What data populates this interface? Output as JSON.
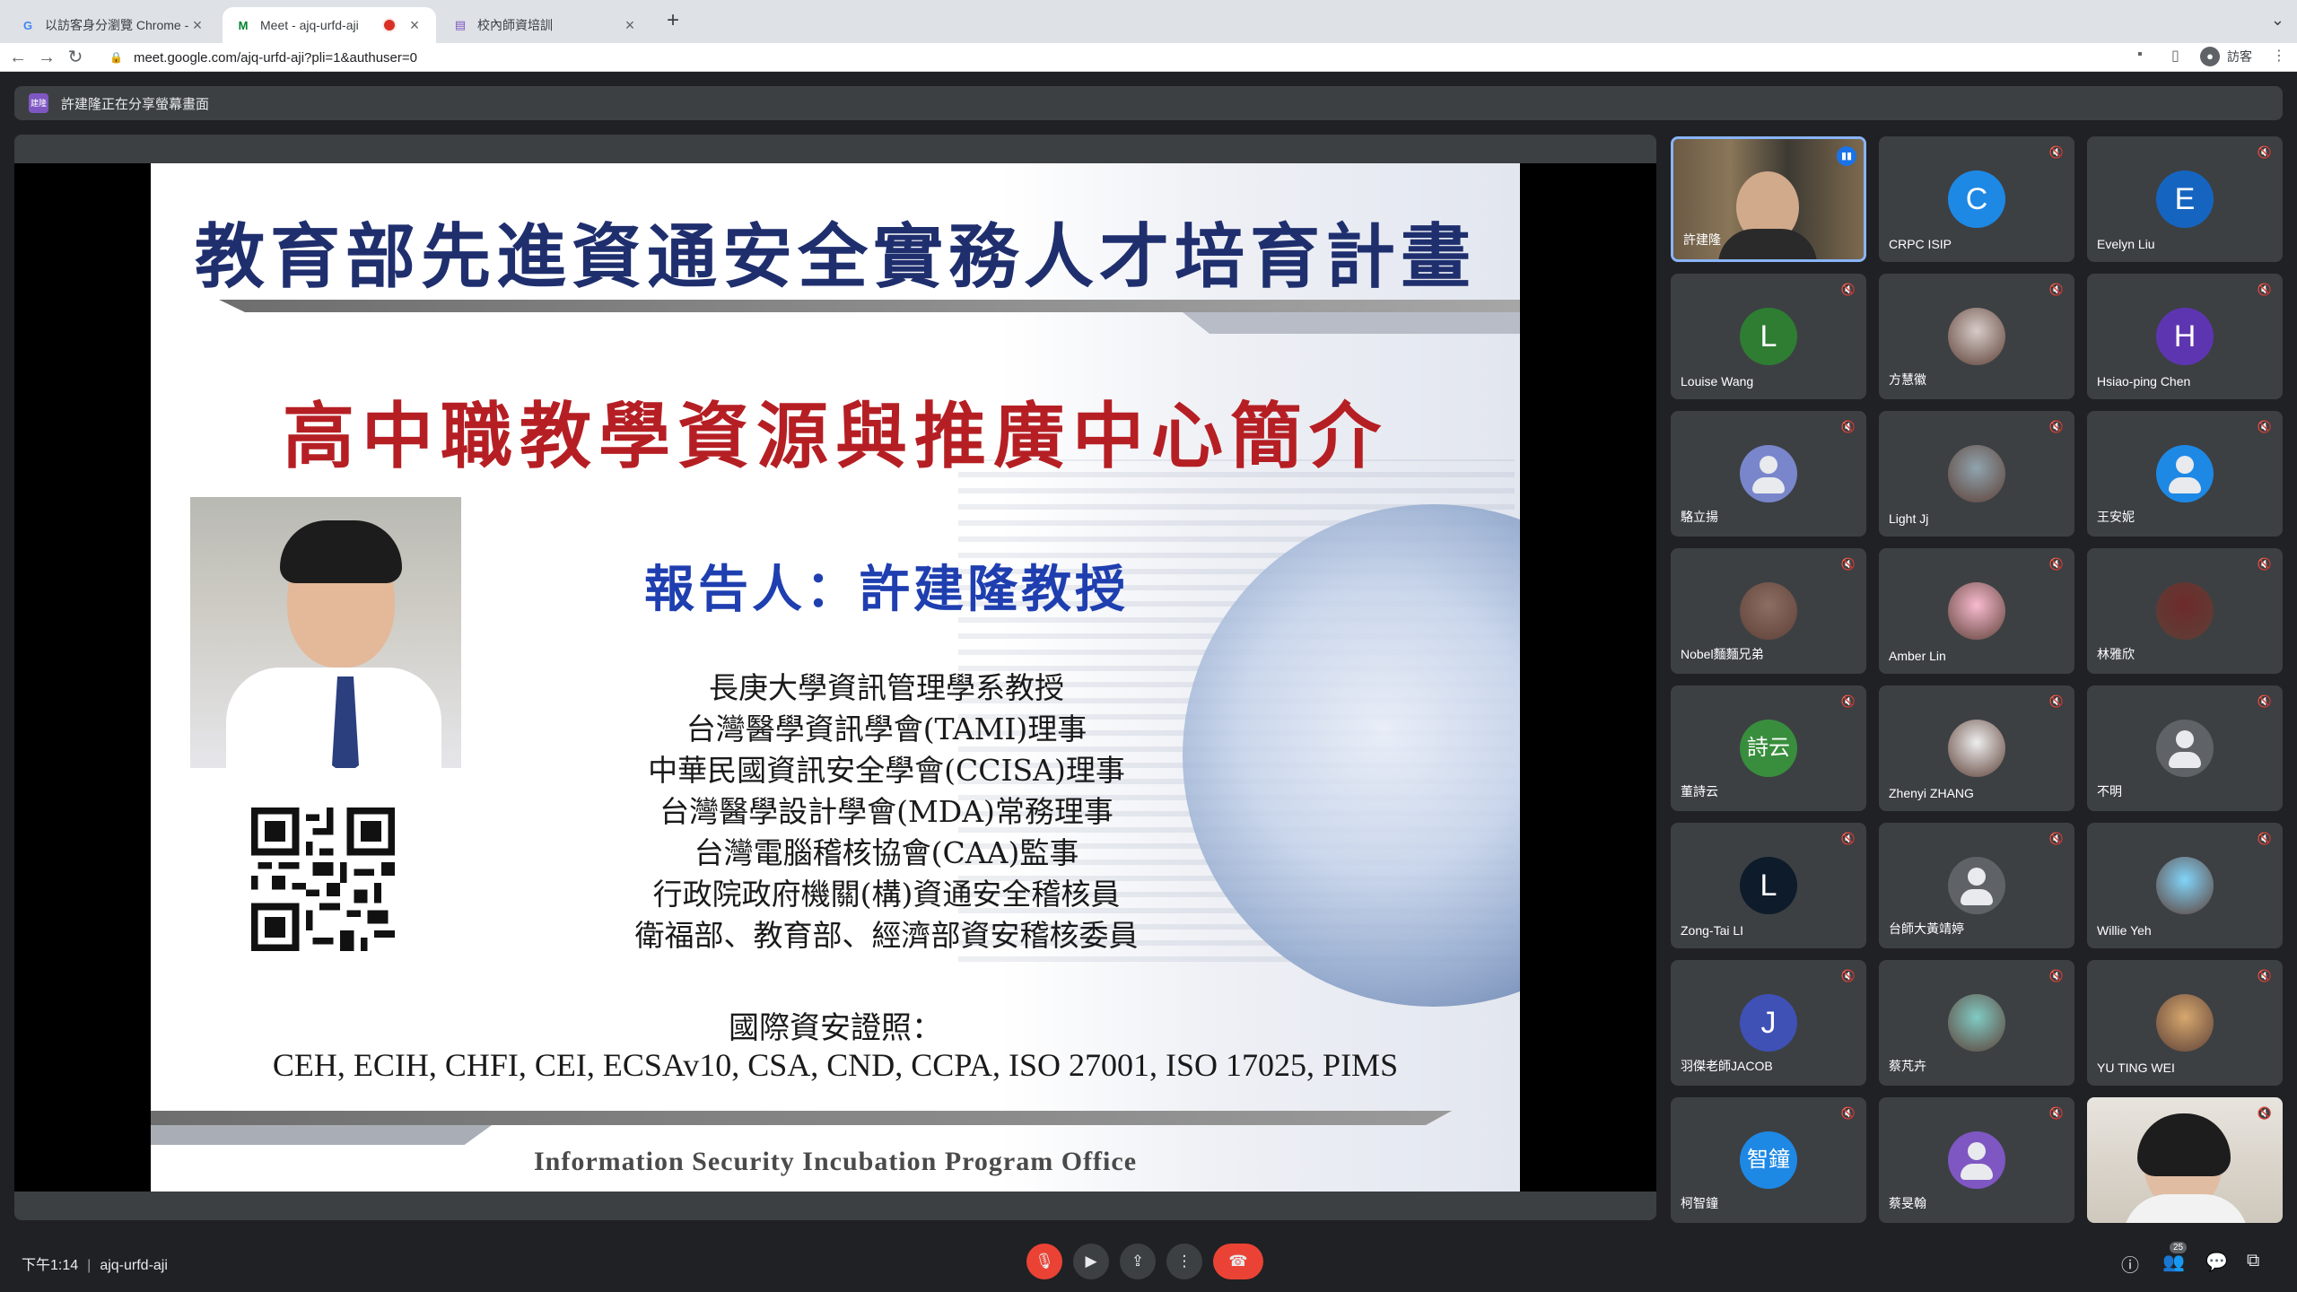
{
  "browser": {
    "tabs": [
      {
        "label": "以訪客身分瀏覽 Chrome - 電腦",
        "favicon": "G",
        "active": false
      },
      {
        "label": "Meet - ajq-urfd-aji",
        "favicon": "M",
        "active": true,
        "recording": true
      },
      {
        "label": "校內師資培訓",
        "favicon": "▤",
        "active": false
      }
    ],
    "url": "meet.google.com/ajq-urfd-aji?pli=1&authuser=0",
    "profile_label": "訪客"
  },
  "meet": {
    "banner_avatar": "建隆",
    "banner_text": "許建隆正在分享螢幕畫面",
    "slide": {
      "headline": "教育部先進資通安全實務人才培育計畫",
      "subtitle": "高中職教學資源與推廣中心簡介",
      "reporter": "報告人：許建隆教授",
      "titles": [
        "長庚大學資訊管理學系教授",
        "台灣醫學資訊學會(TAMI)理事",
        "中華民國資訊安全學會(CCISA)理事",
        "台灣醫學設計學會(MDA)常務理事",
        "台灣電腦稽核協會(CAA)監事",
        "行政院政府機關(構)資通安全稽核員",
        "衛福部、教育部、經濟部資安稽核委員"
      ],
      "cert_label": "國際資安證照：",
      "certs": "CEH, ECIH, CHFI, CEI, ECSAv10, CSA, CND, CCPA, ISO 27001, ISO 17025, PIMS",
      "footer": "Information Security Incubation Program Office"
    },
    "participants": [
      {
        "name": "許建隆",
        "kind": "video",
        "speaking": true
      },
      {
        "name": "CRPC ISIP",
        "kind": "letter",
        "letter": "C",
        "color": "#1e88e5"
      },
      {
        "name": "Evelyn Liu",
        "kind": "letter",
        "letter": "E",
        "color": "#1565c0"
      },
      {
        "name": "Louise Wang",
        "kind": "letter",
        "letter": "L",
        "color": "#2e7d32"
      },
      {
        "name": "方慧徽",
        "kind": "photo",
        "color": "#d7ccc8"
      },
      {
        "name": "Hsiao-ping Chen",
        "kind": "letter",
        "letter": "H",
        "color": "#5e35b1"
      },
      {
        "name": "駱立揚",
        "kind": "generic",
        "color": "#7986cb"
      },
      {
        "name": "Light Jj",
        "kind": "photo",
        "color": "#90a4ae"
      },
      {
        "name": "王安妮",
        "kind": "generic",
        "color": "#1e88e5"
      },
      {
        "name": "Nobel麵麵兄弟",
        "kind": "photo",
        "color": "#8d6e63"
      },
      {
        "name": "Amber Lin",
        "kind": "photo",
        "color": "#f8bbd0"
      },
      {
        "name": "林雅欣",
        "kind": "photo",
        "color": "#6d2b2b"
      },
      {
        "name": "董詩云",
        "kind": "letter",
        "letter": "詩云",
        "color": "#388e3c"
      },
      {
        "name": "Zhenyi ZHANG",
        "kind": "photo",
        "color": "#eeeeee"
      },
      {
        "name": "不明",
        "kind": "generic",
        "color": "#5f6368"
      },
      {
        "name": "Zong-Tai LI",
        "kind": "letter",
        "letter": "L",
        "color": "#0d1b2a"
      },
      {
        "name": "台師大黃靖婷",
        "kind": "generic",
        "color": "#5f6368"
      },
      {
        "name": "Willie Yeh",
        "kind": "photo",
        "color": "#81d4fa"
      },
      {
        "name": "羽傑老師JACOB",
        "kind": "letter",
        "letter": "J",
        "color": "#3f51b5"
      },
      {
        "name": "蔡芃卉",
        "kind": "photo",
        "color": "#80cbc4"
      },
      {
        "name": "YU TING WEI",
        "kind": "photo",
        "color": "#d7a86e"
      },
      {
        "name": "柯智鐘",
        "kind": "letter",
        "letter": "智鐘",
        "color": "#1e88e5"
      },
      {
        "name": "蔡旻翰",
        "kind": "generic",
        "color": "#7e57c2"
      },
      {
        "name": "",
        "kind": "video",
        "speaking": false
      }
    ],
    "bottom": {
      "time": "下午1:14",
      "meeting_code": "ajq-urfd-aji",
      "participant_count": "25"
    }
  }
}
